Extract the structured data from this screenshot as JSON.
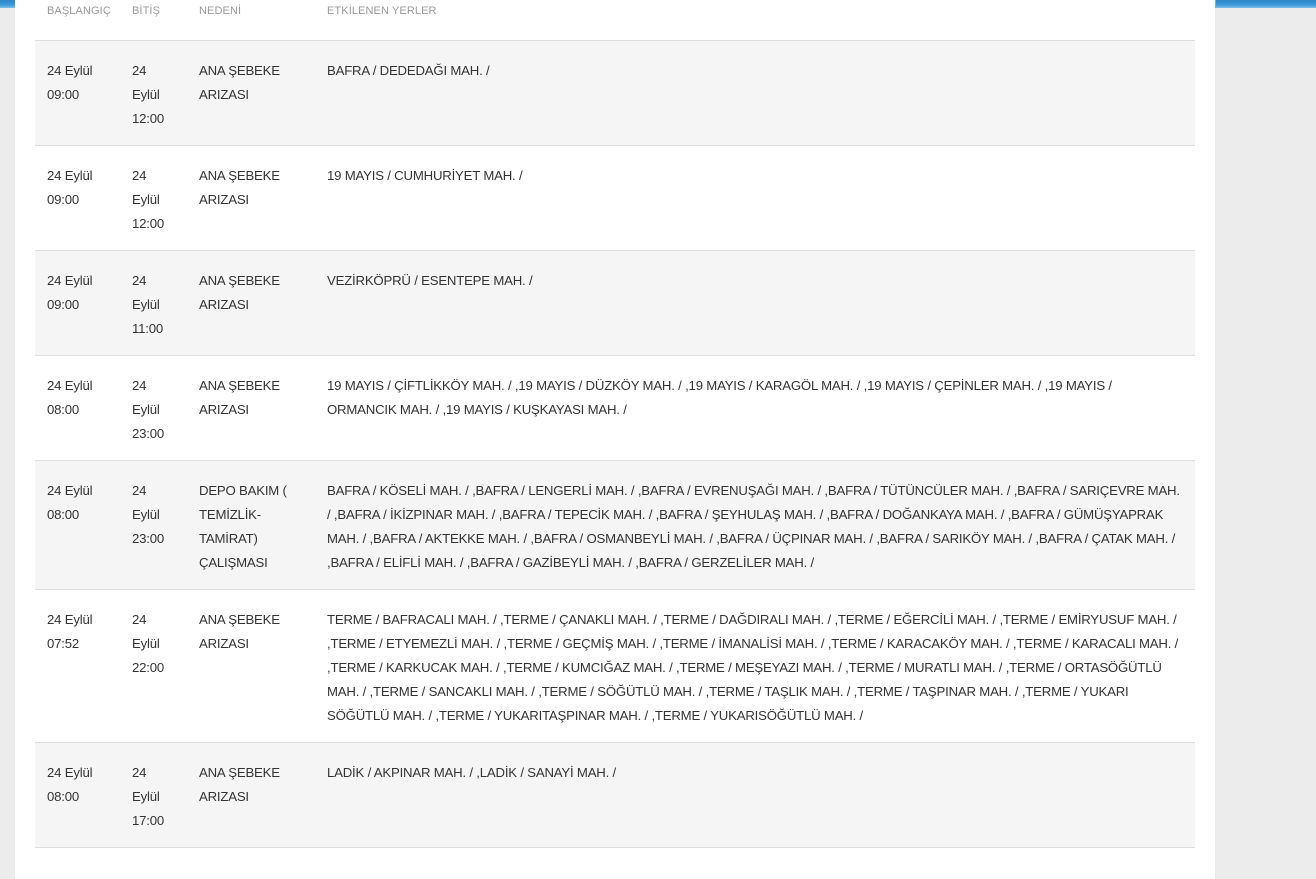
{
  "table": {
    "headers": [
      "BAŞLANGIÇ",
      "BİTİŞ",
      "NEDENİ",
      "ETKİLENEN YERLER"
    ],
    "rows": [
      {
        "start": "24 Eylül 09:00",
        "end": "24 Eylül 12:00",
        "reason": "ANA ŞEBEKE ARIZASI",
        "places": "BAFRA / DEDEDAĞI MAH. /"
      },
      {
        "start": "24 Eylül 09:00",
        "end": "24 Eylül 12:00",
        "reason": "ANA ŞEBEKE ARIZASI",
        "places": "19 MAYIS / CUMHURİYET MAH. /"
      },
      {
        "start": "24 Eylül 09:00",
        "end": "24 Eylül 11:00",
        "reason": "ANA ŞEBEKE ARIZASI",
        "places": "VEZİRKÖPRÜ / ESENTEPE MAH. /"
      },
      {
        "start": "24 Eylül 08:00",
        "end": "24 Eylül 23:00",
        "reason": "ANA ŞEBEKE ARIZASI",
        "places": "19 MAYIS / ÇİFTLİKKÖY MAH. / ,19 MAYIS / DÜZKÖY MAH. / ,19 MAYIS / KARAGÖL MAH. / ,19 MAYIS / ÇEPİNLER MAH. / ,19 MAYIS / ORMANCIK MAH. / ,19 MAYIS / KUŞKAYASI MAH. /"
      },
      {
        "start": "24 Eylül 08:00",
        "end": "24 Eylül 23:00",
        "reason": "DEPO BAKIM ( TEMİZLİK-TAMİRAT) ÇALIŞMASI",
        "places": "BAFRA / KÖSELİ MAH. / ,BAFRA / LENGERLİ MAH. / ,BAFRA / EVRENUŞAĞI MAH. / ,BAFRA / TÜTÜNCÜLER MAH. / ,BAFRA / SARIÇEVRE MAH. / ,BAFRA / İKİZPINAR MAH. / ,BAFRA / TEPECİK MAH. / ,BAFRA / ŞEYHULAŞ MAH. / ,BAFRA / DOĞANKAYA MAH. / ,BAFRA / GÜMÜŞYAPRAK MAH. / ,BAFRA / AKTEKKE MAH. / ,BAFRA / OSMANBEYLİ MAH. / ,BAFRA / ÜÇPINAR MAH. / ,BAFRA / SARIKÖY MAH. / ,BAFRA / ÇATAK MAH. / ,BAFRA / ELİFLİ MAH. / ,BAFRA / GAZİBEYLİ MAH. / ,BAFRA / GERZELİLER MAH. /"
      },
      {
        "start": "24 Eylül 07:52",
        "end": "24 Eylül 22:00",
        "reason": "ANA ŞEBEKE ARIZASI",
        "places": "TERME / BAFRACALI MAH. / ,TERME / ÇANAKLI MAH. / ,TERME / DAĞDIRALI MAH. / ,TERME / EĞERCİLİ MAH. / ,TERME / EMİRYUSUF MAH. / ,TERME / ETYEMEZLİ MAH. / ,TERME / GEÇMİŞ MAH. / ,TERME / İMANALİSİ MAH. / ,TERME / KARACAKÖY MAH. / ,TERME / KARACALI MAH. / ,TERME / KARKUCAK MAH. / ,TERME / KUMCIĞAZ MAH. / ,TERME / MEŞEYAZI MAH. / ,TERME / MURATLI MAH. / ,TERME / ORTASÖĞÜTLÜ MAH. / ,TERME / SANCAKLI MAH. / ,TERME / SÖĞÜTLÜ MAH. / ,TERME / TAŞLIK MAH. / ,TERME / TAŞPINAR MAH. / ,TERME / YUKARI SÖĞÜTLÜ MAH. / ,TERME / YUKARITAŞPINAR MAH. / ,TERME / YUKARISÖĞÜTLÜ MAH. /"
      },
      {
        "start": "24 Eylül 08:00",
        "end": "24 Eylül 17:00",
        "reason": "ANA ŞEBEKE ARIZASI",
        "places": "LADİK / AKPINAR MAH. / ,LADİK / SANAYİ MAH. /"
      }
    ]
  },
  "colors": {
    "header_bar": "#2f86c9",
    "row_stripe": "#f5f5f5",
    "text": "#333333",
    "header_text": "#9a9a9a"
  }
}
